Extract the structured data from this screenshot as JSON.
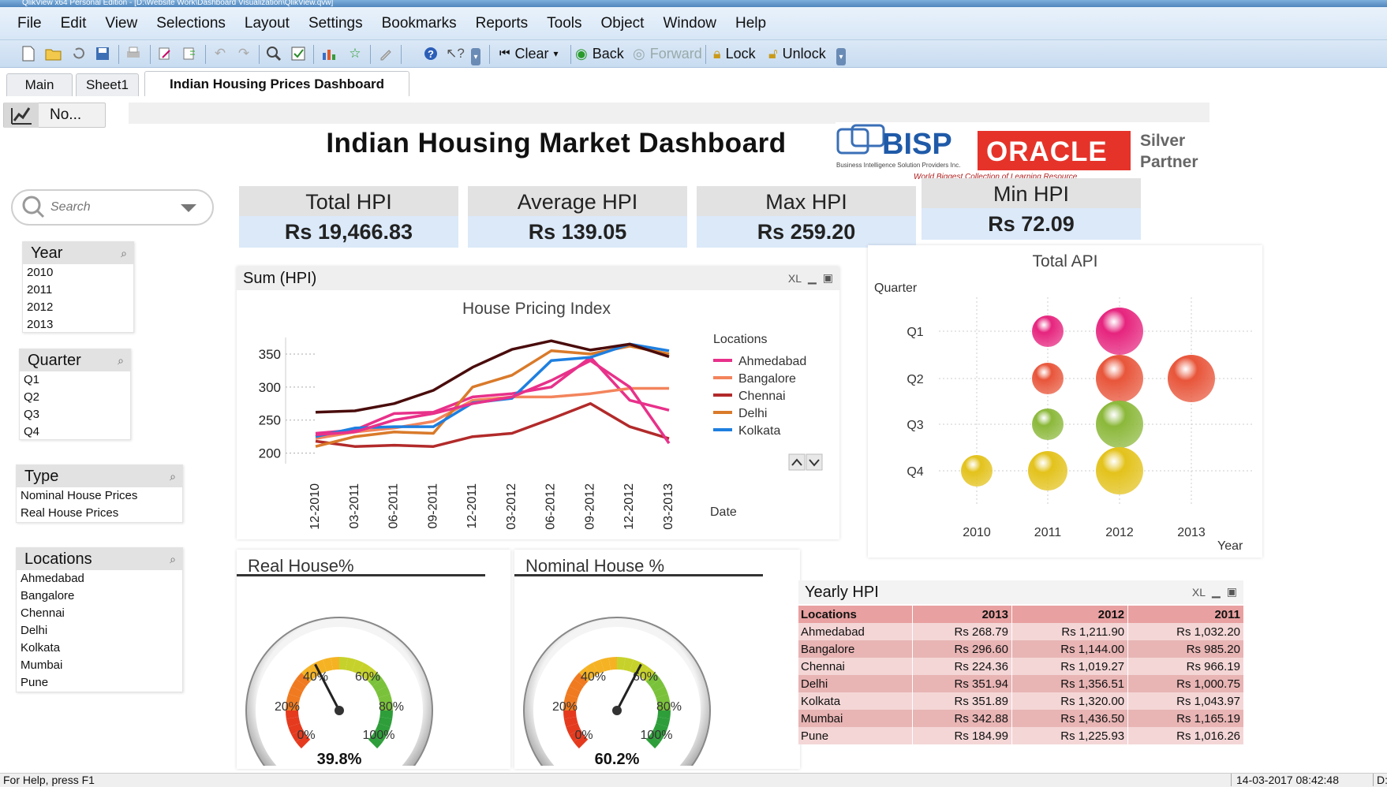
{
  "window": {
    "title": "QlikView x64 Personal Edition - [D:\\Website Work\\Dashboard Visualization\\QlikView.qvw]"
  },
  "menu": [
    "File",
    "Edit",
    "View",
    "Selections",
    "Layout",
    "Settings",
    "Bookmarks",
    "Reports",
    "Tools",
    "Object",
    "Window",
    "Help"
  ],
  "toolbar": {
    "clear_label": "Clear",
    "back_label": "Back",
    "forward_label": "Forward",
    "lock_label": "Lock",
    "unlock_label": "Unlock"
  },
  "tabs": [
    "Main",
    "Sheet1",
    "Indian Housing Prices Dashboard"
  ],
  "no_button_label": "No...",
  "dashboard_title": "Indian Housing Market  Dashboard",
  "logo": {
    "bisp": "BISP",
    "bisp_sub": "Business Intelligence Solution Providers Inc.",
    "oracle": "ORACLE",
    "partner_line1": "Silver",
    "partner_line2": "Partner",
    "tagline": "World Biggest Collection of Learning Resource"
  },
  "search": {
    "placeholder": "Search"
  },
  "listboxes": {
    "year": {
      "title": "Year",
      "items": [
        "2010",
        "2011",
        "2012",
        "2013"
      ]
    },
    "quarter": {
      "title": "Quarter",
      "items": [
        "Q1",
        "Q2",
        "Q3",
        "Q4"
      ]
    },
    "type": {
      "title": "Type",
      "items": [
        "Nominal House Prices",
        "Real House Prices"
      ]
    },
    "locations": {
      "title": "Locations",
      "items": [
        "Ahmedabad",
        "Bangalore",
        "Chennai",
        "Delhi",
        "Kolkata",
        "Mumbai",
        "Pune"
      ]
    }
  },
  "kpis": [
    {
      "label": "Total HPI",
      "value": "Rs 19,466.83"
    },
    {
      "label": "Average HPI",
      "value": "Rs 139.05"
    },
    {
      "label": "Max HPI",
      "value": "Rs 259.20"
    },
    {
      "label": "Min HPI",
      "value": "Rs 72.09"
    }
  ],
  "line_chart": {
    "caption": "Sum (HPI)",
    "xl": "XL"
  },
  "bubble_chart": {
    "caption": "Total API",
    "ylabel": "Quarter",
    "xlabel": "Year"
  },
  "gauges": [
    {
      "title": "Real House%",
      "value": "39.8%",
      "ticks": [
        "0%",
        "20%",
        "40%",
        "60%",
        "80%",
        "100%"
      ]
    },
    {
      "title": "Nominal House %",
      "value": "60.2%",
      "ticks": [
        "0%",
        "20%",
        "40%",
        "60%",
        "80%",
        "100%"
      ]
    }
  ],
  "yearly_table": {
    "caption": "Yearly HPI",
    "xl": "XL",
    "headers": [
      "Locations",
      "2013",
      "2012",
      "2011"
    ],
    "rows": [
      [
        "Ahmedabad",
        "Rs 268.79",
        "Rs 1,211.90",
        "Rs 1,032.20"
      ],
      [
        "Bangalore",
        "Rs 296.60",
        "Rs 1,144.00",
        "Rs 985.20"
      ],
      [
        "Chennai",
        "Rs 224.36",
        "Rs 1,019.27",
        "Rs 966.19"
      ],
      [
        "Delhi",
        "Rs 351.94",
        "Rs 1,356.51",
        "Rs 1,000.75"
      ],
      [
        "Kolkata",
        "Rs 351.89",
        "Rs 1,320.00",
        "Rs 1,043.97"
      ],
      [
        "Mumbai",
        "Rs 342.88",
        "Rs 1,436.50",
        "Rs 1,165.19"
      ],
      [
        "Pune",
        "Rs 184.99",
        "Rs 1,225.93",
        "Rs 1,016.26"
      ]
    ]
  },
  "status": {
    "left": "For Help, press F1",
    "datetime": "14-03-2017 08:42:48",
    "right": "D:"
  },
  "colors": {
    "ahmedabad": "#e8318a",
    "bangalore": "#f3845c",
    "chennai": "#b22a2a",
    "delhi": "#d97a2a",
    "kolkata": "#1e7fe0",
    "darkline": "#4a0c0c",
    "pinkline": "#e8318a"
  },
  "chart_data": [
    {
      "type": "line",
      "title": "House Pricing Index",
      "xlabel": "Date",
      "ylabel": "",
      "legend_title": "Locations",
      "legend_position": "right",
      "categories": [
        "12-2010",
        "03-2011",
        "06-2011",
        "09-2011",
        "12-2011",
        "03-2012",
        "06-2012",
        "09-2012",
        "12-2012",
        "03-2013"
      ],
      "yticks": [
        200,
        250,
        300,
        350
      ],
      "ylim": [
        190,
        375
      ],
      "series": [
        {
          "name": "Ahmedabad",
          "color": "#e8318a",
          "values": [
            230,
            235,
            260,
            262,
            285,
            290,
            300,
            345,
            280,
            265
          ]
        },
        {
          "name": "Bangalore",
          "color": "#f3845c",
          "values": [
            222,
            232,
            238,
            248,
            280,
            285,
            285,
            290,
            298,
            298
          ]
        },
        {
          "name": "Chennai",
          "color": "#b22a2a",
          "values": [
            218,
            210,
            212,
            210,
            225,
            230,
            252,
            275,
            240,
            222
          ]
        },
        {
          "name": "Delhi",
          "color": "#d97a2a",
          "values": [
            210,
            225,
            232,
            230,
            300,
            318,
            355,
            350,
            362,
            350
          ]
        },
        {
          "name": "Kolkata",
          "color": "#1e7fe0",
          "values": [
            225,
            238,
            240,
            240,
            276,
            283,
            340,
            345,
            365,
            355
          ]
        },
        {
          "values": [
            262,
            264,
            275,
            295,
            330,
            357,
            370,
            356,
            365,
            346
          ]
        },
        {
          "values": [
            228,
            232,
            250,
            260,
            275,
            285,
            310,
            340,
            300,
            215
          ]
        }
      ]
    },
    {
      "type": "scatter",
      "title": "Total API",
      "xlabel": "Year",
      "ylabel": "Quarter",
      "x_categories": [
        "2010",
        "2011",
        "2012",
        "2013"
      ],
      "y_categories": [
        "Q1",
        "Q2",
        "Q3",
        "Q4"
      ],
      "points": [
        {
          "x": "2011",
          "y": "Q1",
          "size": 2,
          "color": "#e6247e"
        },
        {
          "x": "2012",
          "y": "Q1",
          "size": 3,
          "color": "#e6247e"
        },
        {
          "x": "2011",
          "y": "Q2",
          "size": 2,
          "color": "#e8553a"
        },
        {
          "x": "2012",
          "y": "Q2",
          "size": 3,
          "color": "#e8553a"
        },
        {
          "x": "2013",
          "y": "Q2",
          "size": 3,
          "color": "#e8553a"
        },
        {
          "x": "2011",
          "y": "Q3",
          "size": 2,
          "color": "#8bb83a"
        },
        {
          "x": "2012",
          "y": "Q3",
          "size": 3,
          "color": "#8bb83a"
        },
        {
          "x": "2010",
          "y": "Q4",
          "size": 2,
          "color": "#e3c21b"
        },
        {
          "x": "2011",
          "y": "Q4",
          "size": 2.5,
          "color": "#e3c21b"
        },
        {
          "x": "2012",
          "y": "Q4",
          "size": 3,
          "color": "#e3c21b"
        }
      ]
    }
  ]
}
